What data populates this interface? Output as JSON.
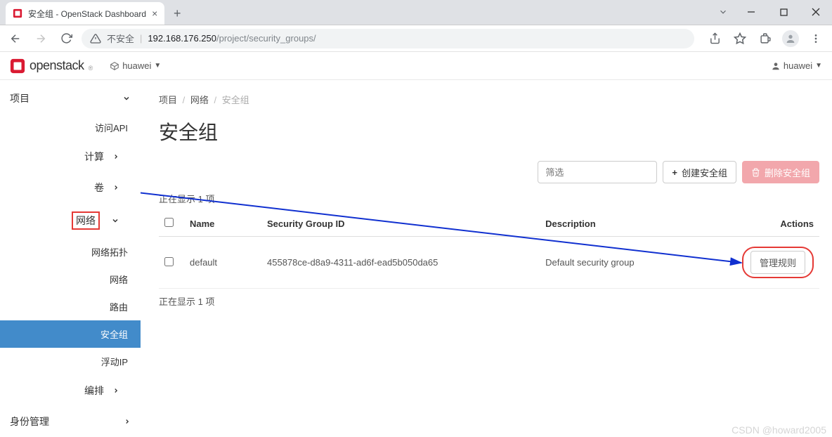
{
  "browser": {
    "tab_title": "安全组 - OpenStack Dashboard",
    "insecure_label": "不安全",
    "url_host": "192.168.176.250",
    "url_path": "/project/security_groups/"
  },
  "header": {
    "brand": "openstack",
    "project_name": "huawei",
    "user_name": "huawei"
  },
  "sidebar": {
    "project": "项目",
    "api_access": "访问API",
    "compute": "计算",
    "volumes": "卷",
    "network": "网络",
    "network_topology": "网络拓扑",
    "networks": "网络",
    "routers": "路由",
    "security_groups": "安全组",
    "floating_ips": "浮动IP",
    "orchestration": "编排",
    "identity": "身份管理"
  },
  "breadcrumb": {
    "l1": "项目",
    "l2": "网络",
    "l3": "安全组"
  },
  "page_title": "安全组",
  "toolbar": {
    "filter_placeholder": "筛选",
    "create_label": "创建安全组",
    "delete_label": "删除安全组"
  },
  "table": {
    "showing": "正在显示 1 项",
    "headers": {
      "name": "Name",
      "sgid": "Security Group ID",
      "desc": "Description",
      "actions": "Actions"
    },
    "row": {
      "name": "default",
      "sgid": "455878ce-d8a9-4311-ad6f-ead5b050da65",
      "desc": "Default security group",
      "action_label": "管理规则"
    }
  },
  "watermark": "CSDN @howard2005"
}
